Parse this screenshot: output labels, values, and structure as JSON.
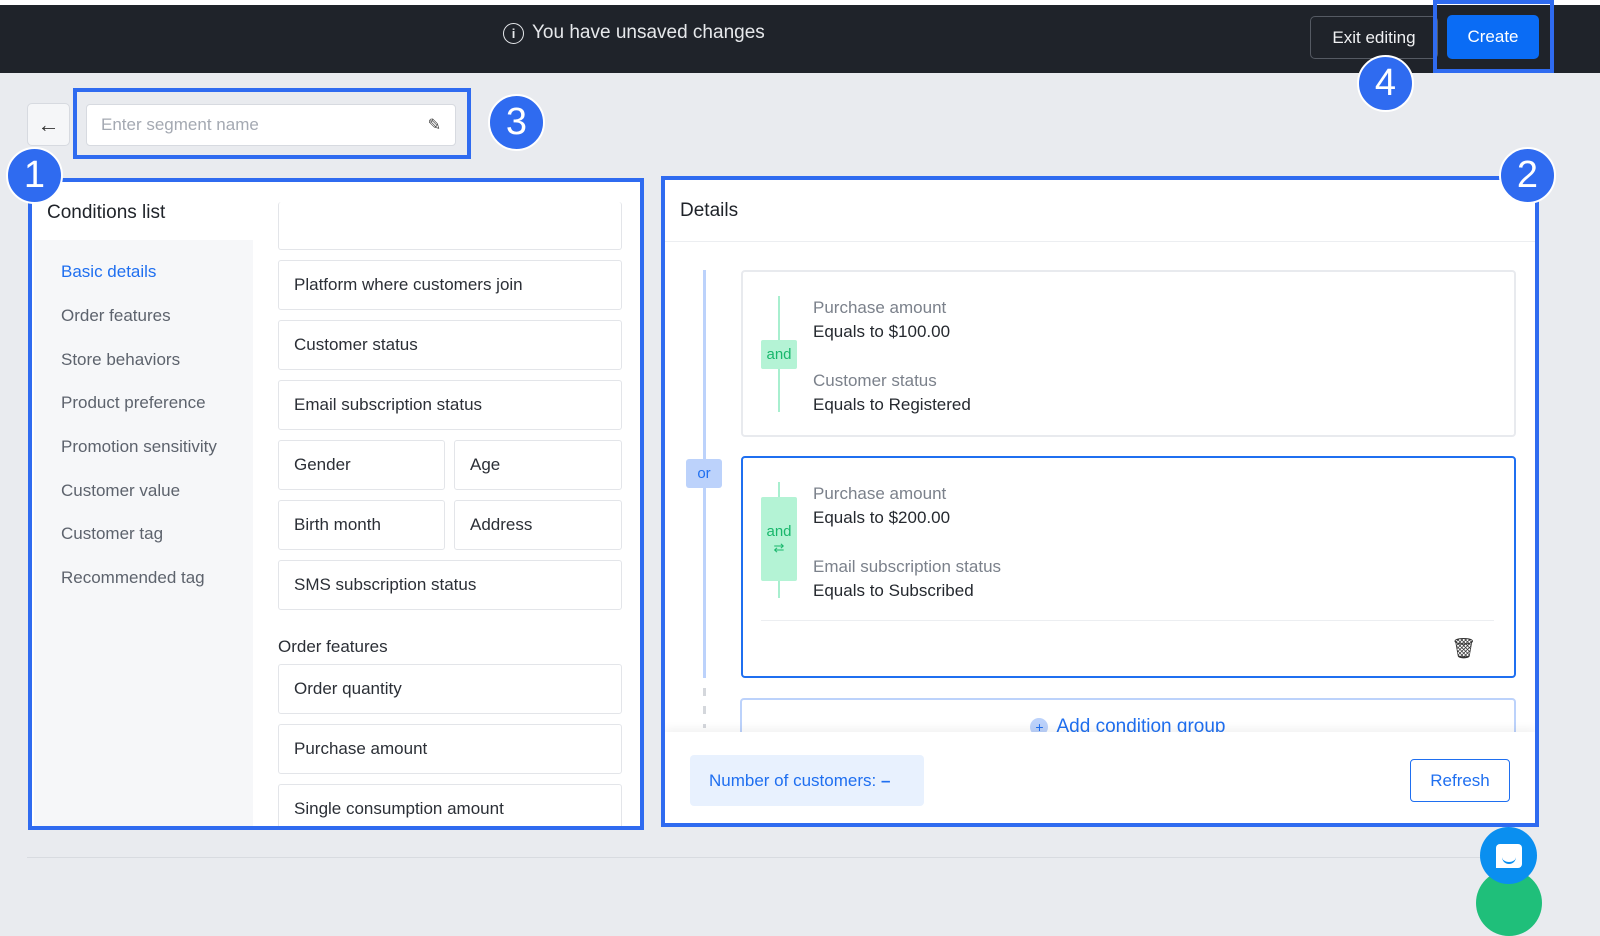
{
  "header": {
    "unsaved_text": "You have unsaved changes",
    "exit_label": "Exit editing",
    "create_label": "Create"
  },
  "annotations": [
    "1",
    "2",
    "3",
    "4"
  ],
  "segment_name": {
    "placeholder": "Enter segment name",
    "value": ""
  },
  "conditions_list": {
    "title": "Conditions list",
    "nav": [
      "Basic details",
      "Order features",
      "Store behaviors",
      "Product preference",
      "Promotion sensitivity",
      "Customer value",
      "Customer tag",
      "Recommended tag"
    ],
    "basic_items": [
      "Platform where customers join",
      "Customer status",
      "Email subscription status",
      "Gender",
      "Age",
      "Birth month",
      "Address",
      "SMS subscription status"
    ],
    "order_section": "Order features",
    "order_items": [
      "Order quantity",
      "Purchase amount",
      "Single consumption amount"
    ]
  },
  "details": {
    "title": "Details",
    "or_label": "or",
    "groups": [
      {
        "and_label": "and",
        "conditions": [
          {
            "label": "Purchase amount",
            "value": "Equals to $100.00"
          },
          {
            "label": "Customer status",
            "value": "Equals to Registered"
          }
        ]
      },
      {
        "and_label": "and",
        "conditions": [
          {
            "label": "Purchase amount",
            "value": "Equals to $200.00"
          },
          {
            "label": "Email subscription status",
            "value": "Equals to Subscribed"
          }
        ]
      }
    ],
    "add_group_label": "Add condition group",
    "customers_label": "Number of customers:",
    "customers_value": "–",
    "refresh_label": "Refresh"
  },
  "colors": {
    "accent": "#1f6ff0",
    "annotation": "#2f6bf0",
    "header": "#1f232a"
  }
}
